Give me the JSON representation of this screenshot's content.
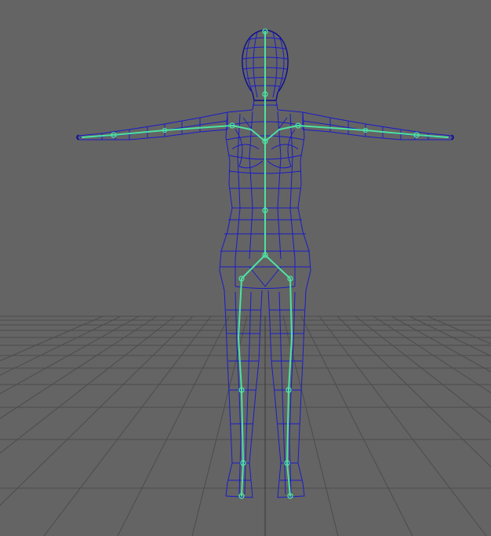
{
  "viewport": {
    "colors": {
      "background": "#646464",
      "grid": "#4c4c4c",
      "grid_axis": "#3a3a3a",
      "mesh_wire": "#1b1bc8",
      "mesh_wire_dark": "#0d0d8a",
      "skeleton": "#4de3a2"
    }
  }
}
